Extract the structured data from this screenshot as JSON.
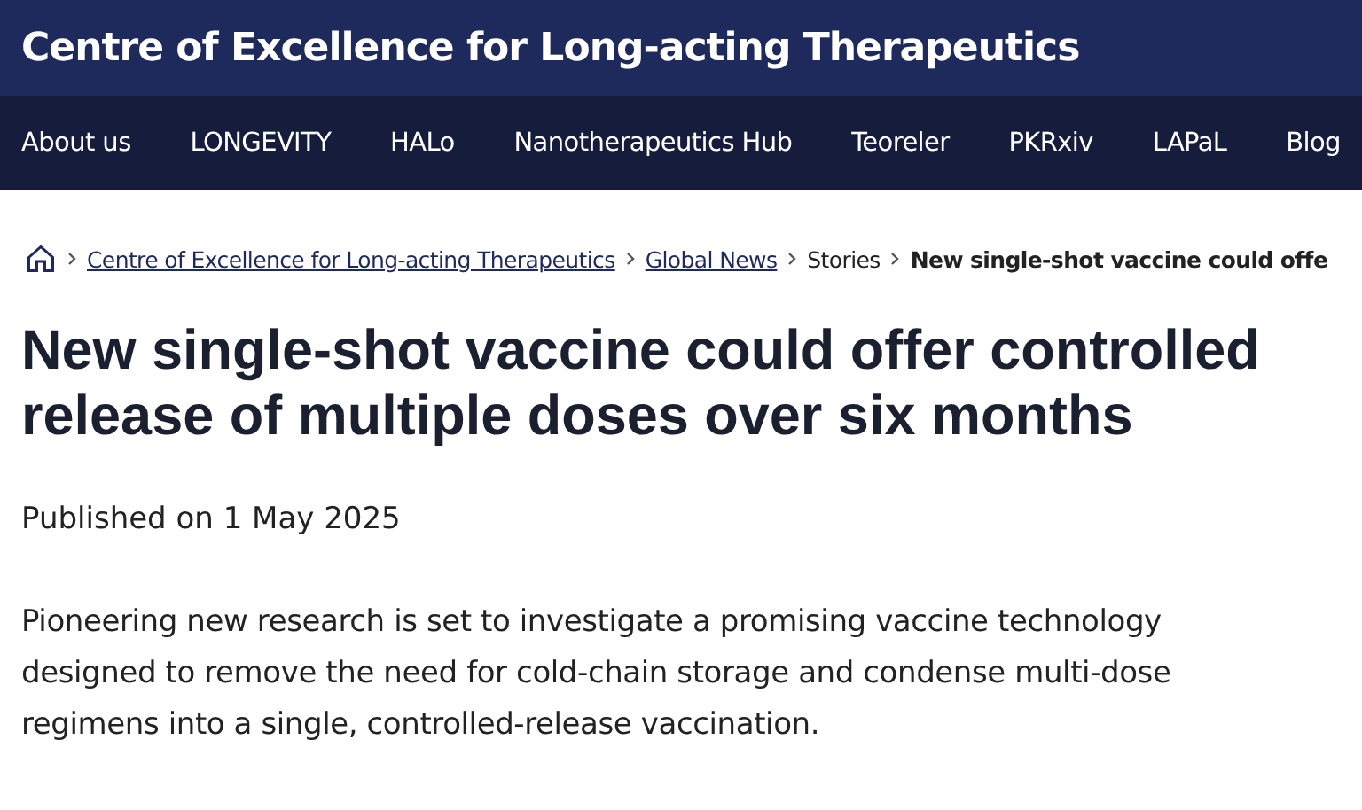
{
  "site_title": "Centre of Excellence for Long-acting Therapeutics",
  "nav": [
    {
      "label": "About us"
    },
    {
      "label": "LONGEVITY"
    },
    {
      "label": "HALo"
    },
    {
      "label": "Nanotherapeutics Hub"
    },
    {
      "label": "Teoreler"
    },
    {
      "label": "PKRxiv"
    },
    {
      "label": "LAPaL"
    },
    {
      "label": "Blog"
    }
  ],
  "breadcrumb": [
    {
      "label": "Centre of Excellence for Long-acting Therapeutics",
      "kind": "link"
    },
    {
      "label": "Global News",
      "kind": "link"
    },
    {
      "label": "Stories",
      "kind": "text"
    },
    {
      "label": "New single-shot vaccine could offe",
      "kind": "current"
    }
  ],
  "headline": "New single-shot vaccine could offer controlled release of multiple doses over six months",
  "published": "Published on 1 May 2025",
  "intro": "Pioneering new research is set to investigate a promising vaccine technology designed to remove the need for cold-chain storage and condense multi-dose regimens into a single, controlled-release vaccination."
}
